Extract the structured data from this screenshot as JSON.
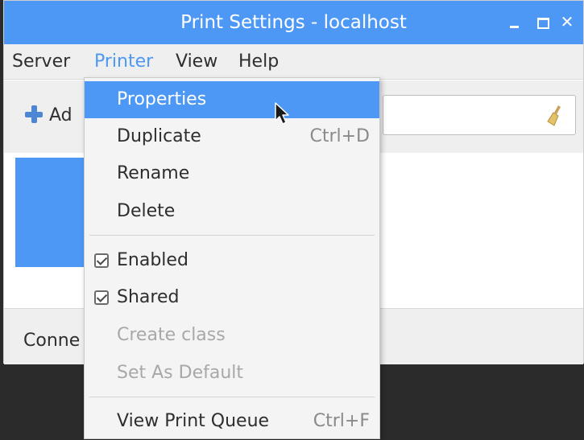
{
  "window": {
    "title": "Print Settings - localhost",
    "controls": {
      "minimize": "–",
      "maximize": "□",
      "close": "✕"
    }
  },
  "menubar": {
    "items": [
      "Server",
      "Printer",
      "View",
      "Help"
    ],
    "active": "Printer"
  },
  "toolbar": {
    "add_label": "Ad",
    "filter_placeholder": ""
  },
  "statusbar": {
    "text": "Conne"
  },
  "printer_menu": {
    "items": [
      {
        "label": "Properties",
        "accel": "",
        "highlighted": true
      },
      {
        "label": "Duplicate",
        "accel": "Ctrl+D"
      },
      {
        "label": "Rename",
        "accel": ""
      },
      {
        "label": "Delete",
        "accel": ""
      },
      {
        "label": "Enabled",
        "checked": true
      },
      {
        "label": "Shared",
        "checked": true
      },
      {
        "label": "Create class",
        "disabled": true
      },
      {
        "label": "Set As Default",
        "disabled": true
      },
      {
        "label": "View Print Queue",
        "accel": "Ctrl+F"
      }
    ]
  },
  "colors": {
    "accent": "#4d98f5",
    "menu_bg": "#f4f4f4",
    "window_bg": "#efefef",
    "disabled_text": "#a8a8a8"
  }
}
